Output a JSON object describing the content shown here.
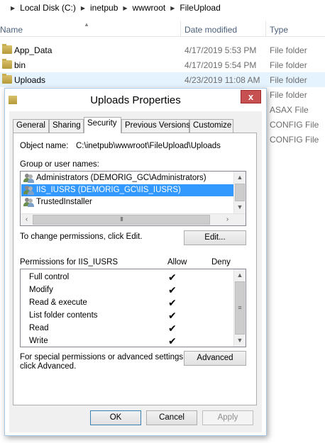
{
  "explorer": {
    "breadcrumb": [
      "Local Disk (C:)",
      "inetpub",
      "wwwroot",
      "FileUpload"
    ],
    "columns": {
      "name": "Name",
      "date_modified": "Date modified",
      "type": "Type"
    },
    "rows": [
      {
        "name": "App_Data",
        "date": "4/17/2019 5:53 PM",
        "type": "File folder"
      },
      {
        "name": "bin",
        "date": "4/17/2019 5:54 PM",
        "type": "File folder"
      },
      {
        "name": "Uploads",
        "date": "4/23/2019 11:08 AM",
        "type": "File folder"
      }
    ],
    "hidden_rows_types": [
      "File folder",
      "ASAX File",
      "CONFIG File",
      "CONFIG File"
    ]
  },
  "dialog": {
    "title": "Uploads Properties",
    "close_label": "x",
    "tabs": [
      "General",
      "Sharing",
      "Security",
      "Previous Versions",
      "Customize"
    ],
    "active_tab": "Security",
    "object_name_label": "Object name:",
    "object_name_value": "C:\\inetpub\\wwwroot\\FileUpload\\Uploads",
    "group_label": "Group or user names:",
    "users": [
      "Administrators (DEMORIG_GC\\Administrators)",
      "IIS_IUSRS (DEMORIG_GC\\IIS_IUSRS)",
      "TrustedInstaller"
    ],
    "selected_user_index": 1,
    "change_text": "To change permissions, click Edit.",
    "edit_button": "Edit...",
    "permissions_label": "Permissions for IIS_IUSRS",
    "allow_label": "Allow",
    "deny_label": "Deny",
    "permissions": [
      {
        "name": "Full control",
        "allow": "✔",
        "deny": ""
      },
      {
        "name": "Modify",
        "allow": "✔",
        "deny": ""
      },
      {
        "name": "Read & execute",
        "allow": "✔",
        "deny": ""
      },
      {
        "name": "List folder contents",
        "allow": "✔",
        "deny": ""
      },
      {
        "name": "Read",
        "allow": "✔",
        "deny": ""
      },
      {
        "name": "Write",
        "allow": "✔",
        "deny": ""
      }
    ],
    "special_text_line1": "For special permissions or advanced settings,",
    "special_text_line2": "click Advanced.",
    "advanced_button": "Advanced",
    "ok_button": "OK",
    "cancel_button": "Cancel",
    "apply_button": "Apply"
  }
}
